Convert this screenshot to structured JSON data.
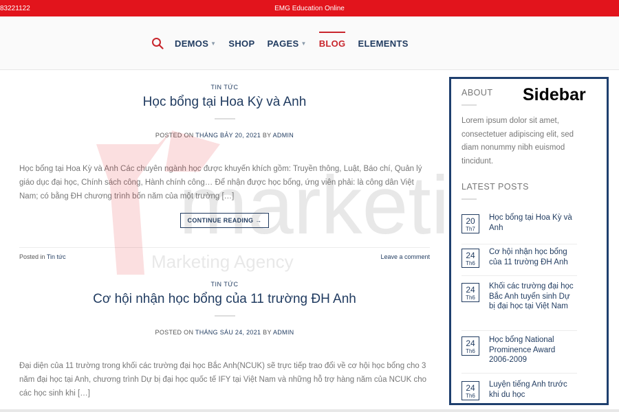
{
  "topbar": {
    "phone": "83221122",
    "brand": "EMG Education Online"
  },
  "nav": {
    "items": [
      {
        "label": "DEMOS",
        "chevron": true,
        "active": false
      },
      {
        "label": "SHOP",
        "chevron": false,
        "active": false
      },
      {
        "label": "PAGES",
        "chevron": true,
        "active": false
      },
      {
        "label": "BLOG",
        "chevron": false,
        "active": true
      },
      {
        "label": "ELEMENTS",
        "chevron": false,
        "active": false
      }
    ]
  },
  "posts": [
    {
      "category": "TIN TỨC",
      "title": "Học bổng tại Hoa Kỳ và Anh",
      "posted_on": "POSTED ON",
      "date": "THÁNG BẢY 20, 2021",
      "by": "BY",
      "author": "ADMIN",
      "excerpt": "Học bổng tại Hoa Kỳ và Anh Các chuyên ngành học được khuyến khích gồm: Truyền thông, Luật, Báo chí, Quản lý giáo dục đại học, Chính sách công, Hành chính công… Để nhận được học bổng, ứng viên phải: là công dân Việt Nam; có bằng ĐH chương trình bốn năm của một trường […]",
      "continue": "CONTINUE READING →",
      "posted_in": "Posted in",
      "posted_in_cat": "Tin tức",
      "comment": "Leave a comment"
    },
    {
      "category": "TIN TỨC",
      "title": "Cơ hội nhận học bổng của 11 trường ĐH Anh",
      "posted_on": "POSTED ON",
      "date": "THÁNG SÁU 24, 2021",
      "by": "BY",
      "author": "ADMIN",
      "excerpt": "Đại diện của 11 trường trong khối các trường đại học Bắc Anh(NCUK) sẽ trực tiếp trao đổi về cơ hội học bổng cho 3 năm đại học tại Anh, chương trình Dự bị đại học quốc tế IFY tại Việt Nam và những hỗ trợ hàng năm của NCUK cho các học sinh khi […]"
    }
  ],
  "watermark": {
    "word": "marketing",
    "tagline": "Marketing Agency"
  },
  "sidebar": {
    "label": "Sidebar",
    "about": {
      "title": "ABOUT",
      "text": "Lorem ipsum dolor sit amet, consectetuer adipiscing elit, sed diam nonummy nibh euismod tincidunt."
    },
    "latest": {
      "title": "LATEST POSTS",
      "items": [
        {
          "day": "20",
          "month": "Th7",
          "title": "Học bổng tại Hoa Kỳ và Anh"
        },
        {
          "day": "24",
          "month": "Th6",
          "title": "Cơ hội nhận học bổng của 11 trường ĐH Anh"
        },
        {
          "day": "24",
          "month": "Th6",
          "title": "Khối các trường đại học Bắc Anh tuyển sinh Dự bị đại học tại Việt Nam"
        },
        {
          "day": "24",
          "month": "Th6",
          "title": "Học bổng National Prominence Award 2006-2009"
        },
        {
          "day": "24",
          "month": "Th6",
          "title": "Luyện tiếng Anh trước khi du học"
        }
      ]
    }
  },
  "colors": {
    "topbar": "#e2141c",
    "navy": "#1f3a5f",
    "active": "#c8252c",
    "sidebar_border": "#1e3f6e"
  }
}
